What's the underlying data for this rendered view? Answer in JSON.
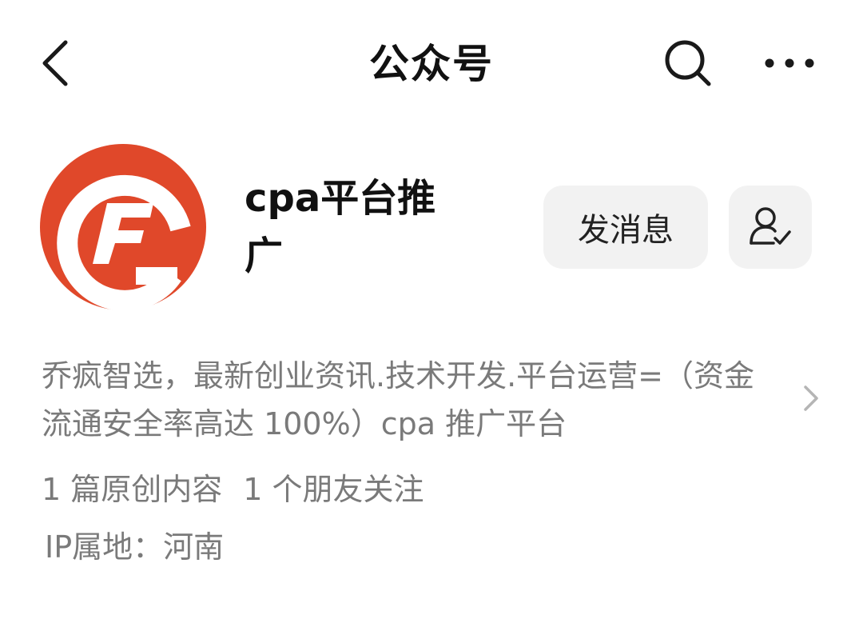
{
  "header": {
    "title": "公众号",
    "back_icon": "chevron-left-icon",
    "search_icon": "search-icon",
    "more_icon": "more-horizontal-icon"
  },
  "profile": {
    "name": "cpa平台推广",
    "avatar_icon": "account-logo",
    "avatar_color": "#e0482a",
    "message_button_label": "发消息",
    "follow_icon": "user-followed-icon"
  },
  "intro": {
    "text": "乔疯智选，最新创业资讯.技术开发.平台运营=（资金流通安全率高达 100%）cpa 推广平台",
    "chevron_icon": "chevron-right-icon"
  },
  "stats": {
    "articles": "1 篇原创内容",
    "friends": "1 个朋友关注"
  },
  "ip_location": "IP属地：河南"
}
